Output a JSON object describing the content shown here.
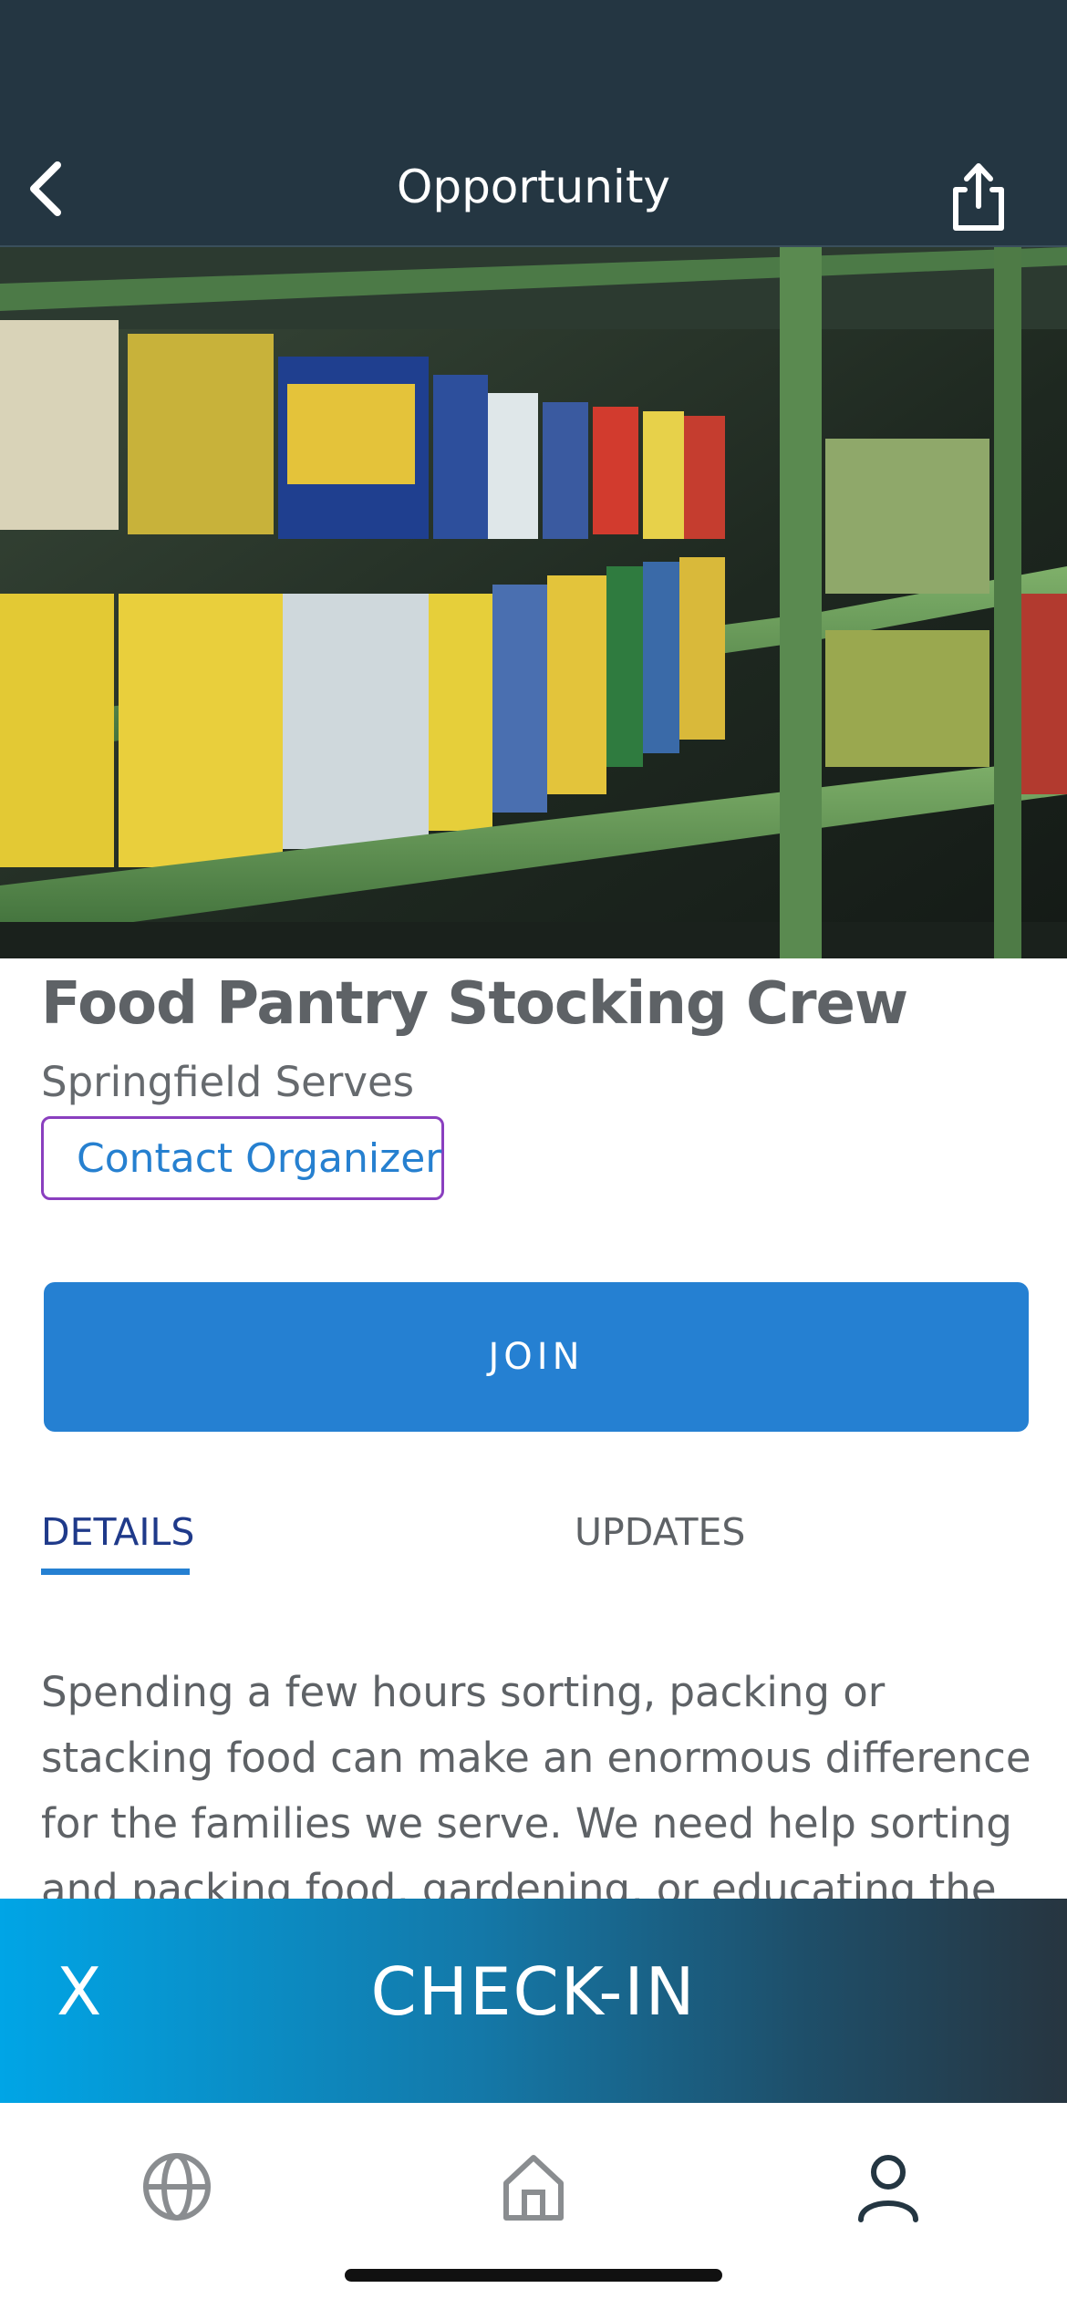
{
  "header": {
    "title": "Opportunity",
    "back_icon": "chevron-left-icon",
    "share_icon": "share-icon"
  },
  "hero": {
    "alt": "canned food on pantry shelves"
  },
  "opportunity": {
    "title": "Food Pantry Stocking Crew",
    "organization": "Springfield Serves",
    "contact_label": "Contact Organizer",
    "join_label": "JOIN"
  },
  "tabs": [
    {
      "label": "DETAILS",
      "active": true
    },
    {
      "label": "UPDATES",
      "active": false
    }
  ],
  "description": "Spending a few hours sorting, packing or stacking food can make an enormous difference for the families we serve. We need help sorting and packing food, gardening, or educating the community. Each",
  "checkin": {
    "close_label": "X",
    "label": "CHECK-IN"
  },
  "bottom_nav": [
    {
      "name": "globe-icon",
      "active": false
    },
    {
      "name": "home-icon",
      "active": false
    },
    {
      "name": "profile-icon",
      "active": true
    }
  ],
  "colors": {
    "header_bg": "#243642",
    "accent": "#2580d2",
    "contact_border": "#8a3fbf",
    "gradient_start": "#00a5e6",
    "gradient_end": "#273540"
  }
}
